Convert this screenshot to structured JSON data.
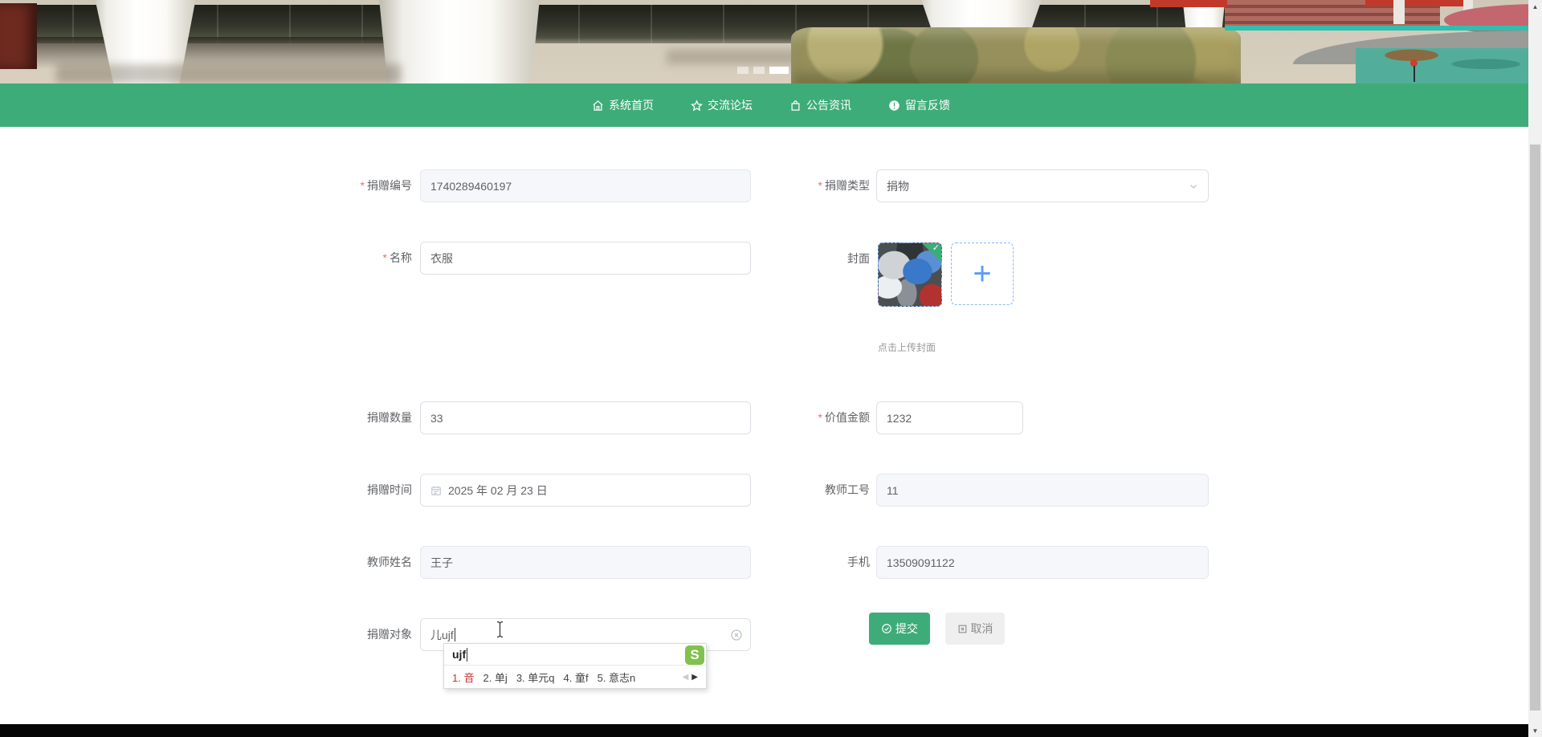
{
  "page": {
    "required_mark": "*"
  },
  "nav": {
    "items": [
      {
        "label": "系统首页",
        "icon": "home-icon"
      },
      {
        "label": "交流论坛",
        "icon": "star-icon"
      },
      {
        "label": "公告资讯",
        "icon": "bag-icon"
      },
      {
        "label": "留言反馈",
        "icon": "info-icon"
      }
    ]
  },
  "form": {
    "donation_id": {
      "label": "捐赠编号",
      "value": "1740289460197",
      "required": true,
      "disabled": true
    },
    "donation_type": {
      "label": "捐赠类型",
      "value": "捐物",
      "required": true
    },
    "item_name": {
      "label": "名称",
      "value": "衣服",
      "required": true
    },
    "cover": {
      "label": "封面",
      "hint": "点击上传封面"
    },
    "quantity": {
      "label": "捐赠数量",
      "value": "33"
    },
    "amount": {
      "label": "价值金额",
      "value": "1232",
      "required": true
    },
    "donate_time": {
      "label": "捐赠时间",
      "value": "2025 年 02 月 23 日"
    },
    "teacher_id": {
      "label": "教师工号",
      "value": "11",
      "disabled": true
    },
    "teacher_name": {
      "label": "教师姓名",
      "value": "王子",
      "disabled": true
    },
    "phone": {
      "label": "手机",
      "value": "13509091122",
      "disabled": true
    },
    "target": {
      "label": "捐赠对象",
      "value": "儿ujf"
    },
    "submit_label": "提交",
    "cancel_label": "取消"
  },
  "ime": {
    "composition": "ujf",
    "candidates": [
      "1. 音",
      "2. 单j",
      "3. 单元q",
      "4. 童f",
      "5. 意志n"
    ],
    "prev_arrow": "◀",
    "next_arrow": "▶",
    "logo": "S"
  },
  "colors": {
    "primary_green": "#3eac78",
    "upload_blue": "#5e9bf2",
    "asterisk_red": "#f56c6c",
    "candidate_red": "#c23531",
    "sogou_green": "#6ab82d"
  }
}
